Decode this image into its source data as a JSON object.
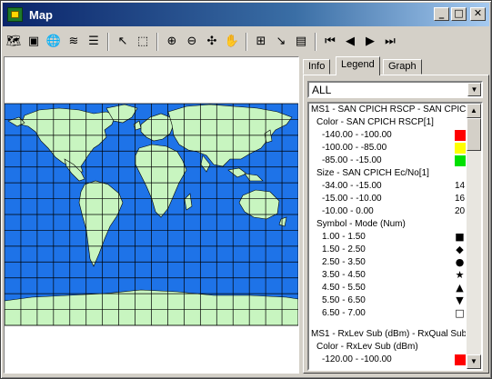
{
  "window": {
    "title": "Map",
    "minimize": "_",
    "maximize": "□",
    "close": "✕"
  },
  "toolbar": {
    "groups": [
      [
        {
          "name": "add-layer-icon",
          "glyph": "🗺"
        },
        {
          "name": "image-icon",
          "glyph": "▣"
        },
        {
          "name": "globe-icon",
          "glyph": "🌐"
        },
        {
          "name": "layers-icon",
          "glyph": "≋"
        },
        {
          "name": "list-icon",
          "glyph": "☰"
        }
      ],
      [
        {
          "name": "select-arrow-icon",
          "glyph": "↖"
        },
        {
          "name": "select-region-icon",
          "glyph": "⬚"
        }
      ],
      [
        {
          "name": "zoom-in-icon",
          "glyph": "⊕"
        },
        {
          "name": "zoom-out-icon",
          "glyph": "⊖"
        },
        {
          "name": "zoom-extent-icon",
          "glyph": "✣"
        },
        {
          "name": "pan-hand-icon",
          "glyph": "✋"
        }
      ],
      [
        {
          "name": "ruler-icon",
          "glyph": "⊞"
        },
        {
          "name": "point-info-icon",
          "glyph": "↘"
        },
        {
          "name": "report-icon",
          "glyph": "▤"
        }
      ],
      [
        {
          "name": "first-icon",
          "glyph": "⏮"
        },
        {
          "name": "previous-icon",
          "glyph": "◀"
        },
        {
          "name": "next-icon",
          "glyph": "▶"
        },
        {
          "name": "last-icon",
          "glyph": "⏭"
        }
      ]
    ]
  },
  "tabs": {
    "info": "Info",
    "legend": "Legend",
    "graph": "Graph"
  },
  "legend": {
    "filter": "ALL",
    "rows": [
      {
        "kind": "h1",
        "text": "MS1 - SAN CPICH RSCP - SAN CPIC"
      },
      {
        "kind": "h2",
        "text": "Color - SAN CPICH RSCP[1]"
      },
      {
        "kind": "item",
        "text": "-140.00 - -100.00",
        "swatch": "#ff0000"
      },
      {
        "kind": "item",
        "text": "-100.00 - -85.00",
        "swatch": "#ffff00"
      },
      {
        "kind": "item",
        "text": "-85.00 - -15.00",
        "swatch": "#00e000"
      },
      {
        "kind": "h2",
        "text": "Size - SAN CPICH Ec/No[1]"
      },
      {
        "kind": "item",
        "text": "-34.00 - -15.00",
        "num": "14"
      },
      {
        "kind": "item",
        "text": "-15.00 - -10.00",
        "num": "16"
      },
      {
        "kind": "item",
        "text": "-10.00 - 0.00",
        "num": "20"
      },
      {
        "kind": "h2",
        "text": "Symbol - Mode (Num)"
      },
      {
        "kind": "item",
        "text": "1.00 - 1.50",
        "symbol": "■",
        "symbol_name": "square-symbol-icon"
      },
      {
        "kind": "item",
        "text": "1.50 - 2.50",
        "symbol": "◆",
        "symbol_name": "diamond-symbol-icon"
      },
      {
        "kind": "item",
        "text": "2.50 - 3.50",
        "symbol": "●",
        "symbol_name": "circle-symbol-icon"
      },
      {
        "kind": "item",
        "text": "3.50 - 4.50",
        "symbol": "★",
        "symbol_name": "star-symbol-icon"
      },
      {
        "kind": "item",
        "text": "4.50 - 5.50",
        "symbol": "▲",
        "symbol_name": "triangle-up-symbol-icon"
      },
      {
        "kind": "item",
        "text": "5.50 - 6.50",
        "symbol": "▼",
        "symbol_name": "triangle-down-symbol-icon"
      },
      {
        "kind": "item",
        "text": "6.50 - 7.00",
        "symbol": "□",
        "symbol_name": "hollow-square-symbol-icon"
      },
      {
        "kind": "gap"
      },
      {
        "kind": "h1",
        "text": "MS1 - RxLev Sub (dBm) - RxQual Sub"
      },
      {
        "kind": "h2",
        "text": "Color - RxLev Sub (dBm)"
      },
      {
        "kind": "item",
        "text": "-120.00 - -100.00",
        "swatch": "#ff0000"
      }
    ]
  },
  "colors": {
    "ocean": "#1e73e8",
    "land": "#c8f5c0",
    "grid": "#000000"
  }
}
